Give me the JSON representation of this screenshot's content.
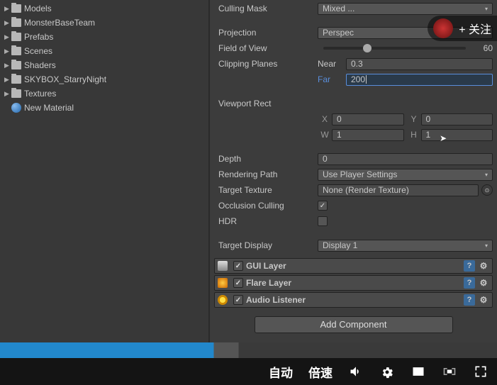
{
  "sidebar": {
    "items": [
      {
        "label": "Models",
        "type": "folder"
      },
      {
        "label": "MonsterBaseTeam",
        "type": "folder"
      },
      {
        "label": "Prefabs",
        "type": "folder"
      },
      {
        "label": "Scenes",
        "type": "folder"
      },
      {
        "label": "Shaders",
        "type": "folder"
      },
      {
        "label": "SKYBOX_StarryNight",
        "type": "folder"
      },
      {
        "label": "Textures",
        "type": "folder"
      },
      {
        "label": "New Material",
        "type": "material"
      }
    ]
  },
  "inspector": {
    "culling_mask": {
      "label": "Culling Mask",
      "value": "Mixed ..."
    },
    "projection": {
      "label": "Projection",
      "value": "Perspec"
    },
    "fov": {
      "label": "Field of View",
      "value": "60"
    },
    "clipping": {
      "label": "Clipping Planes",
      "near_label": "Near",
      "near": "0.3",
      "far_label": "Far",
      "far": "200"
    },
    "viewport": {
      "label": "Viewport Rect",
      "x_label": "X",
      "x": "0",
      "y_label": "Y",
      "y": "0",
      "w_label": "W",
      "w": "1",
      "h_label": "H",
      "h": "1"
    },
    "depth": {
      "label": "Depth",
      "value": "0"
    },
    "rendering_path": {
      "label": "Rendering Path",
      "value": "Use Player Settings"
    },
    "target_texture": {
      "label": "Target Texture",
      "value": "None (Render Texture)"
    },
    "occlusion": {
      "label": "Occlusion Culling",
      "checked": true
    },
    "hdr": {
      "label": "HDR",
      "checked": false
    },
    "target_display": {
      "label": "Target Display",
      "value": "Display 1"
    },
    "components": [
      {
        "name": "GUI Layer",
        "checked": true,
        "icon": "layer"
      },
      {
        "name": "Flare Layer",
        "checked": true,
        "icon": "flare"
      },
      {
        "name": "Audio Listener",
        "checked": true,
        "icon": "audio"
      }
    ],
    "add_component": "Add Component"
  },
  "follow": {
    "label": "+ 关注"
  },
  "videobar": {
    "auto": "自动",
    "speed": "倍速"
  }
}
